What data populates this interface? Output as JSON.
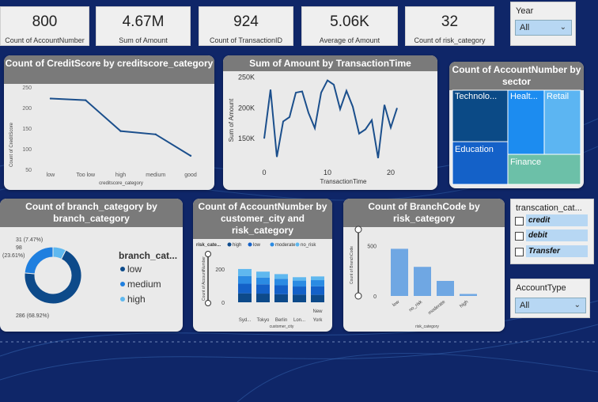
{
  "kpis": [
    {
      "value": "800",
      "label": "Count of AccountNumber"
    },
    {
      "value": "4.67M",
      "label": "Sum of Amount"
    },
    {
      "value": "924",
      "label": "Count of TransactionID"
    },
    {
      "value": "5.06K",
      "label": "Average of Amount"
    },
    {
      "value": "32",
      "label": "Count of risk_category"
    }
  ],
  "year_slicer": {
    "title": "Year",
    "selected": "All"
  },
  "transaction_slicer": {
    "title": "transcation_cat...",
    "options": [
      "credit",
      "debit",
      "Transfer"
    ]
  },
  "account_type_slicer": {
    "title": "AccountType",
    "selected": "All"
  },
  "colors": {
    "background": "#0f2668",
    "header": "#7a7a7a",
    "card": "#eaeaea",
    "dark": "#0d4a8a",
    "medium": "#1f7fdf",
    "light": "#5fb8ef"
  },
  "chart_data": [
    {
      "type": "line",
      "title": "Count of CreditScore by creditscore_category",
      "xlabel": "creditscore_category",
      "ylabel": "Count of CreditScore",
      "categories": [
        "low",
        "Too low",
        "high",
        "medium",
        "good"
      ],
      "values": [
        222,
        218,
        143,
        135,
        83
      ],
      "ylim": [
        50,
        250
      ],
      "yticks": [
        50,
        100,
        150,
        200,
        250
      ]
    },
    {
      "type": "line",
      "title": "Sum of Amount by TransactionTime",
      "xlabel": "TransactionTime",
      "ylabel": "Sum of Amount",
      "x": [
        0,
        1,
        2,
        3,
        4,
        5,
        6,
        7,
        8,
        9,
        10,
        11,
        12,
        13,
        14,
        15,
        16,
        17,
        18,
        19,
        20,
        21,
        22,
        23
      ],
      "values": [
        150,
        230,
        120,
        178,
        185,
        225,
        227,
        192,
        167,
        225,
        245,
        238,
        198,
        228,
        202,
        158,
        165,
        180,
        118,
        205,
        168,
        200
      ],
      "xticks": [
        "0",
        "10",
        "20"
      ],
      "yticks": [
        "150K",
        "200K",
        "250K"
      ],
      "ylim": [
        110,
        260
      ]
    },
    {
      "type": "treemap",
      "title": "Count of AccountNumber by sector",
      "items": [
        {
          "label": "Technolo...",
          "color": "#0b4a86"
        },
        {
          "label": "Healt...",
          "color": "#1c8cf0"
        },
        {
          "label": "Retail",
          "color": "#5cb5f2"
        },
        {
          "label": "Education",
          "color": "#1461c8"
        },
        {
          "label": "Finance",
          "color": "#6cc0a8"
        }
      ]
    },
    {
      "type": "pie",
      "title": "Count of branch_category by branch_category",
      "legend_title": "branch_cat...",
      "slices": [
        {
          "name": "low",
          "value": 286,
          "label": "286 (68.92%)",
          "color": "#0d4a8a"
        },
        {
          "name": "medium",
          "value": 98,
          "label": "98 (23.61%)",
          "color": "#1f7fdf"
        },
        {
          "name": "high",
          "value": 31,
          "label": "31 (7.47%)",
          "color": "#5fb8ef"
        }
      ]
    },
    {
      "type": "bar",
      "title": "Count of AccountNumber by customer_city and risk_category",
      "legend_title": "risk_cate...",
      "xlabel": "customer_city",
      "ylabel": "Count of AccountNumber",
      "categories": [
        "Syd...",
        "Tokyo",
        "Berlin",
        "Lon...",
        "New York"
      ],
      "series": [
        {
          "name": "high",
          "color": "#0d4a8a",
          "values": [
            58,
            56,
            52,
            50,
            48
          ]
        },
        {
          "name": "low",
          "color": "#1461c8",
          "values": [
            62,
            60,
            58,
            52,
            55
          ]
        },
        {
          "name": "moderate",
          "color": "#2b8be3",
          "values": [
            50,
            44,
            42,
            38,
            40
          ]
        },
        {
          "name": "no_risk",
          "color": "#5fb8ef",
          "values": [
            45,
            38,
            30,
            22,
            24
          ]
        }
      ],
      "yticks": [
        "0",
        "200"
      ],
      "ylim": [
        0,
        300
      ]
    },
    {
      "type": "bar",
      "title": "Count of BranchCode by risk_category",
      "xlabel": "risk_category",
      "ylabel": "Count of BranchCode",
      "categories": [
        "low",
        "no_risk",
        "moderate",
        "high"
      ],
      "values": [
        470,
        290,
        150,
        20
      ],
      "yticks": [
        "0",
        "500"
      ],
      "ylim": [
        0,
        560
      ],
      "color": "#6fa7e3"
    }
  ]
}
